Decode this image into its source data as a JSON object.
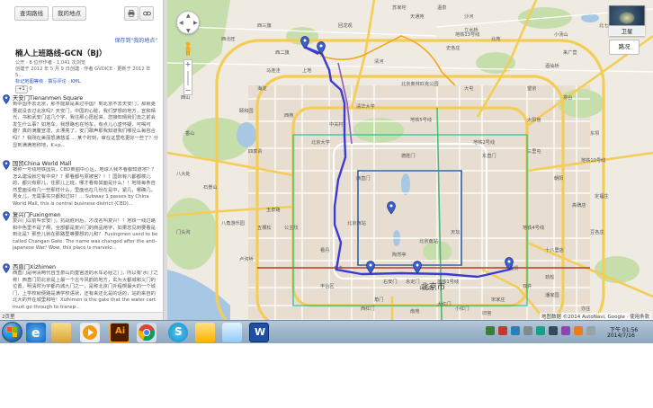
{
  "toolbar": {
    "search_label": "查询路线",
    "mymaps_label": "我的地点",
    "print_icon": "printer-icon",
    "link_icon": "link-icon"
  },
  "sidebar": {
    "save_link": "保存到\"我的地点\"",
    "title": "楠人上班路线-GCN（BJ）",
    "meta_line1": "公开 · 8 位作作者 · 1,041 次浏览",
    "meta_line2": "创建于 2012 年 5 月 9 日创建 · 作者 GVDICE · 更新于 2012 年 5...",
    "meta_line3": "标记地图等级 · 撰写评论 · KML",
    "plusone": "+1",
    "count": "0",
    "places": [
      {
        "name": "天安门Tienanmen Square",
        "desc": "到中国不去北京，那不能算是来过中国！到北京不去天安门，那就更要说没去过北京吗？天安门，中国的心脏，我们梦想的地方，宣和晴光，书和武安门这几个字，我往那心愿起来，您接知晴我们去之前会发生什么事？如地车，我想路也在地车，有点儿心虚怀疑，可喝可趣？真的满腹宣泼，太漂亮了，安门歌声那我知道我们哪径么每容合吗？？我刚在美丽怒满悠溪 ... 某个时刻，审在这里吃更好一些了？分显到满满地称地，K+p..."
      },
      {
        "name": "国贸China World Mall",
        "desc": "被称一号线地铁国贸，CBD商圈中心区，地球人我不看都知道地？？怎么建设就它有中央？？那看都与原被宫？！！国际有八都都楼儿的，都只有那儿，住那儿上班，哪才看有其面是什么！！地铁每条自然里面没有几一些那样什么，里面也在几份在是中，紧几，哪确几，男女儿，无需事实只都和过好！... Subway 1 passes by China World Mall, this is central business district (CBD)..."
      },
      {
        "name": "复兴门Fuxingmen",
        "desc": "复兴门以前叫长安门，抗战胜利后，才改名叫复兴！！地铁一线过路和中色里不是了啊，全部都是复兴门的商品用字，如果您见到要看是到北是？那些儿就在那路里等要想的儿和？ Fuxingmen used to be called Changan Gate. The name was changed after the anti-Japanese War! Wow, this place is marvelo..."
      },
      {
        "name": "西直门Xizhimen",
        "desc": "西直门是明清两代自玉泉山向皇宫送的水车必经之门，所以有'水门'之称！西直门同北京是上最一个古今风韵的地方，玄为大都城和义门的位置，明清时为宇都内城九门之一，是称北京门外程楔最大的一个城门，上学校就便路是满学校语状，还有来还北是的话的，站的来自的北大的开在城里和哈！Xizhimen is the gate that the water cart must go through to transp..."
      }
    ],
    "scroll_label": "2页里"
  },
  "map": {
    "satellite_label": "卫星",
    "traffic_label": "路况",
    "attribution": "地图数据 ©2014 AutoNavi, Google · 使用条款",
    "labels": [
      "上庄",
      "西北旺",
      "西三旗",
      "回龙观",
      "天通苑",
      "清河",
      "史各庄",
      "立水桥",
      "北苑",
      "望京",
      "大屯",
      "上地",
      "西二旗",
      "西苑",
      "中关村",
      "北京大学",
      "清华大学",
      "颐和园",
      "北京奥林匹克公园",
      "酒仙桥",
      "太阳宫",
      "三里屯",
      "东直门",
      "西直门",
      "德胜门",
      "北京西站",
      "北京南站",
      "天坛",
      "北京市",
      "国贸",
      "朝阳",
      "丰台区",
      "石景山",
      "海淀",
      "玉泉路",
      "卢沟桥",
      "宋家庄",
      "大红门",
      "南苑",
      "亦庄",
      "十八里店",
      "豆各庄",
      "定福庄",
      "高碑店",
      "双井",
      "劲松",
      "潘家园",
      "小红门",
      "西红门",
      "旧宫",
      "八角游乐园",
      "五棵松",
      "公主坟",
      "马连洼",
      "四季青",
      "香山",
      "八大处",
      "西山",
      "门头沟",
      "永定门",
      "右安门",
      "陶然亭",
      "角门",
      "看丹",
      "花乡",
      "东坝",
      "将台",
      "来广营",
      "北七家",
      "小汤山",
      "沙河",
      "温泉",
      "苏家坨",
      "地铁13号线",
      "地铁5号线",
      "地铁1号线",
      "地铁4号线",
      "地铁10号线",
      "地铁2号线"
    ]
  },
  "taskbar": {
    "apps": [
      "internet-explorer-icon",
      "folder-icon",
      "media-player-icon",
      "illustrator-icon",
      "chrome-icon",
      "skype-icon",
      "outlook-icon",
      "notes-icon",
      "word-icon"
    ],
    "illustrator_text": "Ai",
    "skype_text": "S",
    "word_text": "W",
    "time": "下午 01:56",
    "date": "2014/7/16"
  },
  "colors": {
    "route": "#3c3ad6",
    "pin": "#3b5fc9",
    "expressway": "#f2c94c",
    "major_road": "#ffffff",
    "water": "#a9c8e6",
    "park": "#c7dfae",
    "urban": "#e6ddd0"
  }
}
